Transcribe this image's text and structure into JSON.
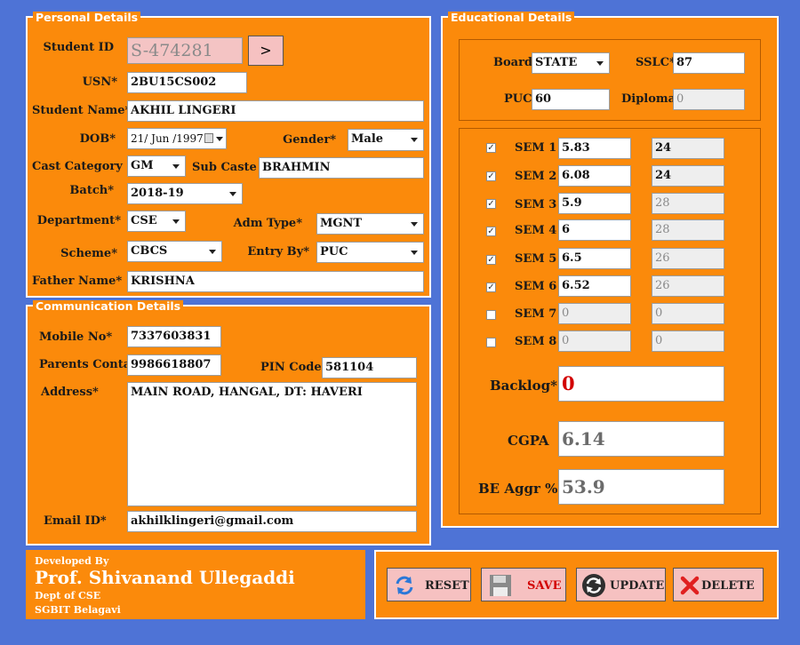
{
  "personal": {
    "legend": "Personal Details",
    "student_id_label": "Student ID",
    "student_id": "S-474281",
    "go_label": ">",
    "usn_label": "USN*",
    "usn": "2BU15CS002",
    "name_label": "Student Name*",
    "name": "AKHIL LINGERI",
    "dob_label": "DOB*",
    "dob": "21/ Jun /1997",
    "gender_label": "Gender*",
    "gender": "Male",
    "caste_cat_label": "Cast Category",
    "caste_cat": "GM",
    "sub_caste_label": "Sub Caste",
    "sub_caste": "BRAHMIN",
    "batch_label": "Batch*",
    "batch": "2018-19",
    "dept_label": "Department*",
    "dept": "CSE",
    "adm_type_label": "Adm Type*",
    "adm_type": "MGNT",
    "scheme_label": "Scheme*",
    "scheme": "CBCS",
    "entry_by_label": "Entry By*",
    "entry_by": "PUC",
    "father_label": "Father Name*",
    "father": "KRISHNA"
  },
  "communication": {
    "legend": "Communication Details",
    "mobile_label": "Mobile No*",
    "mobile": "7337603831",
    "parents_label": "Parents Contact",
    "parents": "9986618807",
    "pin_label": "PIN Code",
    "pin": "581104",
    "address_label": "Address*",
    "address": "MAIN ROAD, HANGAL, DT: HAVERI",
    "email_label": "Email ID*",
    "email": "akhilklingeri@gmail.com"
  },
  "education": {
    "legend": "Educational Details",
    "board_label": "Board",
    "board": "STATE",
    "sslc_label": "SSLC*",
    "sslc": "87",
    "puc_label": "PUC",
    "puc": "60",
    "diploma_label": "Diploma",
    "diploma": "0",
    "sems": [
      {
        "label": "SEM 1",
        "sgpa": "5.83",
        "credits": "24",
        "checked": true
      },
      {
        "label": "SEM 2",
        "sgpa": "6.08",
        "credits": "24",
        "checked": true
      },
      {
        "label": "SEM 3",
        "sgpa": "5.9",
        "credits": "28",
        "checked": true
      },
      {
        "label": "SEM 4",
        "sgpa": "6",
        "credits": "28",
        "checked": true
      },
      {
        "label": "SEM 5",
        "sgpa": "6.5",
        "credits": "26",
        "checked": true
      },
      {
        "label": "SEM 6",
        "sgpa": "6.52",
        "credits": "26",
        "checked": true
      },
      {
        "label": "SEM 7",
        "sgpa": "0",
        "credits": "0",
        "checked": false
      },
      {
        "label": "SEM 8",
        "sgpa": "0",
        "credits": "0",
        "checked": false
      }
    ],
    "check_glyph": "✓",
    "backlog_label": "Backlog*",
    "backlog": "0",
    "cgpa_label": "CGPA",
    "cgpa": "6.14",
    "aggr_label": "BE Aggr %",
    "aggr": "53.9"
  },
  "footer": {
    "developed_by": "Developed By",
    "developer": "Prof. Shivanand Ullegaddi",
    "dept": "Dept of CSE",
    "college": "SGBIT Belagavi"
  },
  "actions": {
    "reset": "RESET",
    "save": "SAVE",
    "update": "UPDATE",
    "delete": "DELETE"
  },
  "colors": {
    "background": "#4e73d6",
    "panel": "#fb8a0b",
    "button": "#f6c1c1",
    "backlog": "#d20000"
  }
}
